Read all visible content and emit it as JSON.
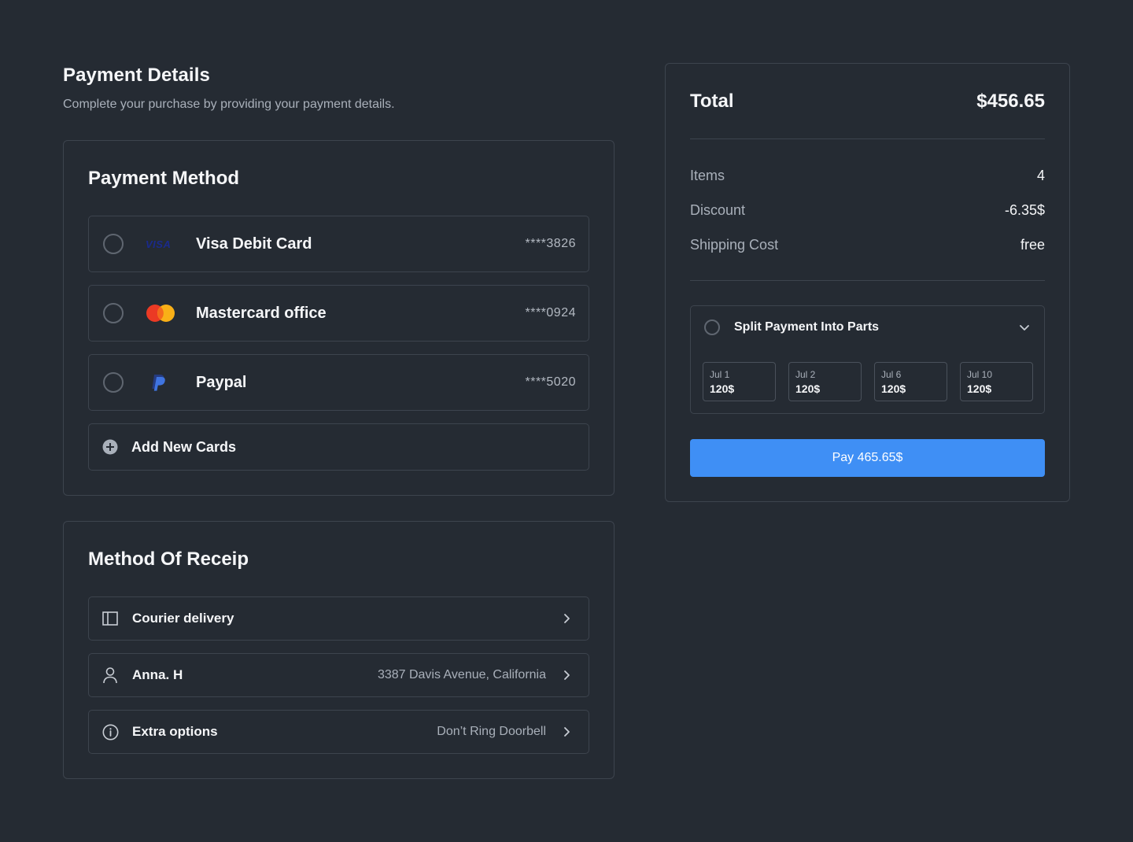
{
  "header": {
    "title": "Payment Details",
    "subtitle": "Complete your purchase by providing your payment details."
  },
  "payment_method": {
    "title": "Payment Method",
    "methods": [
      {
        "label": "Visa Debit Card",
        "number": "****3826",
        "icon": "visa-logo-icon",
        "brand_text": "VISA"
      },
      {
        "label": "Mastercard office",
        "number": "****0924",
        "icon": "mastercard-logo-icon"
      },
      {
        "label": "Paypal",
        "number": "****5020",
        "icon": "paypal-logo-icon"
      }
    ],
    "add_label": "Add New Cards"
  },
  "receipt": {
    "title": "Method Of Receip",
    "rows": [
      {
        "label": "Courier delivery",
        "value": "",
        "icon": "sidebar-layout-icon"
      },
      {
        "label": "Anna. H",
        "value": "3387 Davis Avenue, California",
        "icon": "user-icon"
      },
      {
        "label": "Extra options",
        "value": "Don’t Ring Doorbell",
        "icon": "info-icon"
      }
    ]
  },
  "summary": {
    "total_label": "Total",
    "total_value": "$456.65",
    "rows": [
      {
        "label": "Items",
        "value": "4"
      },
      {
        "label": "Discount",
        "value": "-6.35$"
      },
      {
        "label": "Shipping Cost",
        "value": "free"
      }
    ],
    "split": {
      "label": "Split Payment Into Parts",
      "parts": [
        {
          "date": "Jul 1",
          "amount": "120$"
        },
        {
          "date": "Jul 2",
          "amount": "120$"
        },
        {
          "date": "Jul 6",
          "amount": "120$"
        },
        {
          "date": "Jul 10",
          "amount": "120$"
        }
      ]
    },
    "pay_label": "Pay 465.65$"
  },
  "colors": {
    "background": "#252b33",
    "border": "#3d444e",
    "accent": "#3f8ff5",
    "mastercard_red": "#eb3a24",
    "mastercard_yellow": "#f9b017",
    "visa_blue": "#1a2a8c",
    "paypal_blue": "#2f5bd8"
  }
}
